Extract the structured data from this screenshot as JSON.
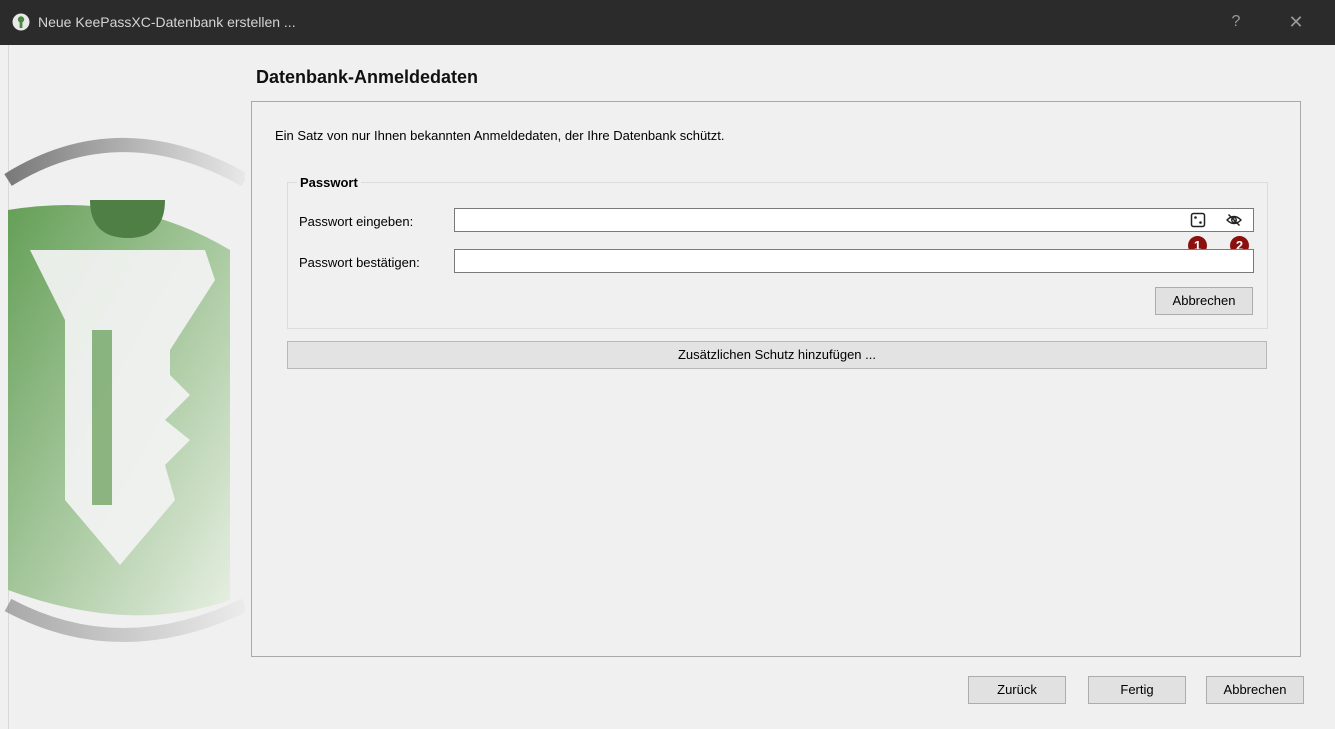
{
  "window": {
    "title": "Neue KeePassXC-Datenbank erstellen ...",
    "help_label": "?",
    "close_label": "✕"
  },
  "page": {
    "heading": "Datenbank-Anmeldedaten",
    "description": "Ein Satz von nur Ihnen bekannten Anmeldedaten, der Ihre Datenbank schützt."
  },
  "password_group": {
    "title": "Passwort",
    "enter_label": "Passwort eingeben:",
    "enter_value": "",
    "confirm_label": "Passwort bestätigen:",
    "confirm_value": "",
    "cancel_label": "Abbrechen",
    "generator_icon": "dice-icon",
    "toggle_visibility_icon": "eye-slash-icon"
  },
  "markers": [
    "1",
    "2"
  ],
  "additional_protection_label": "Zusätzlichen Schutz hinzufügen ...",
  "footer": {
    "back_label": "Zurück",
    "finish_label": "Fertig",
    "cancel_label": "Abbrechen"
  },
  "colors": {
    "titlebar": "#2b2b2b",
    "accent_green": "#5d9b4f",
    "marker_red": "#8b0f0f"
  }
}
